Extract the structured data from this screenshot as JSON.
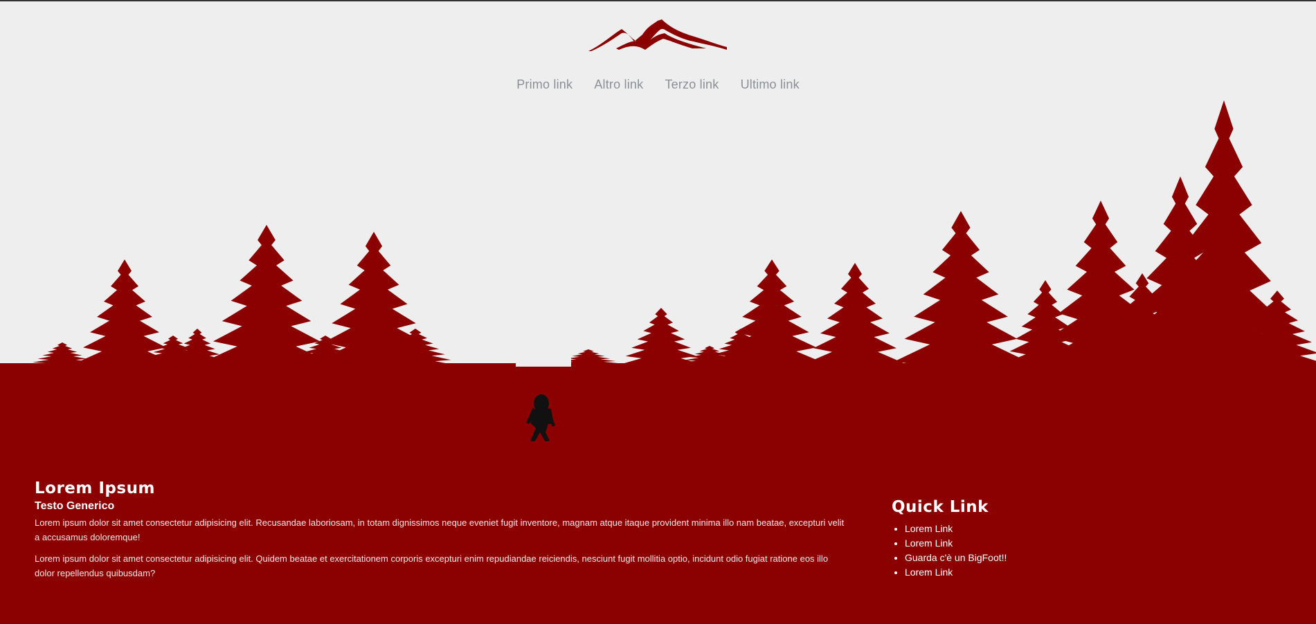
{
  "nav": {
    "items": [
      {
        "label": "Primo link"
      },
      {
        "label": "Altro link"
      },
      {
        "label": "Terzo link"
      },
      {
        "label": "Ultimo link"
      }
    ]
  },
  "footer": {
    "title": "Lorem Ipsum",
    "subtitle": "Testo Generico",
    "para1": "Lorem ipsum dolor sit amet consectetur adipisicing elit. Recusandae laboriosam, in totam dignissimos neque eveniet fugit inventore, magnam atque itaque provident minima illo nam beatae, excepturi velit a accusamus doloremque!",
    "para2": "Lorem ipsum dolor sit amet consectetur adipisicing elit. Quidem beatae et exercitationem corporis excepturi enim repudiandae reiciendis, nesciunt fugit mollitia optio, incidunt odio fugiat ratione eos illo dolor repellendus quibusdam?",
    "quick": {
      "title": "Quick Link",
      "links": [
        "Lorem Link",
        "Lorem Link",
        "Guarda c'è un BigFoot!!",
        "Lorem Link"
      ]
    }
  },
  "colors": {
    "brand": "#8b0000",
    "background": "#eeeeee",
    "nav_text": "#8a8f96"
  },
  "icons": {
    "logo": "mountain-logo-icon",
    "figure": "bigfoot-icon"
  }
}
